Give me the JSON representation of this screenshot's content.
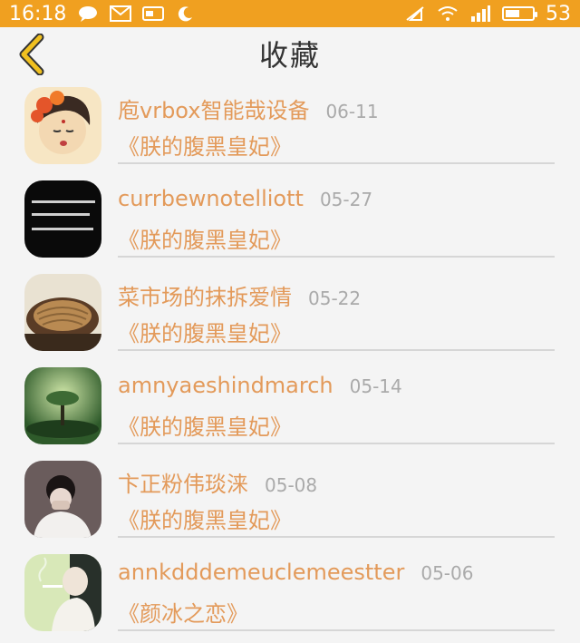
{
  "status_bar": {
    "time": "16:18",
    "battery": "53",
    "battery_level": 0.53
  },
  "header": {
    "title": "收藏",
    "back_icon": "chevron-left-icon",
    "accent_color": "#f0a020"
  },
  "items": [
    {
      "name": "庖vrbox智能哉设备",
      "date": "06-11",
      "book": "《朕的腹黑皇妃》",
      "avatar": "avatar-cartoon-girl"
    },
    {
      "name": "currbewnotelliott",
      "date": "05-27",
      "book": "《朕的腹黑皇妃》",
      "avatar": "avatar-black-text"
    },
    {
      "name": "菜市场的抹拆爱情",
      "date": "05-22",
      "book": "《朕的腹黑皇妃》",
      "avatar": "avatar-noodles"
    },
    {
      "name": "amnyaeshindmarch",
      "date": "05-14",
      "book": "《朕的腹黑皇妃》",
      "avatar": "avatar-green-tree"
    },
    {
      "name": "卞正粉伟琰涞",
      "date": "05-08",
      "book": "《朕的腹黑皇妃》",
      "avatar": "avatar-person-bw"
    },
    {
      "name": "annkdddemeuclemeestter",
      "date": "05-06",
      "book": "《颜冰之恋》",
      "avatar": "avatar-smoking-person"
    }
  ]
}
